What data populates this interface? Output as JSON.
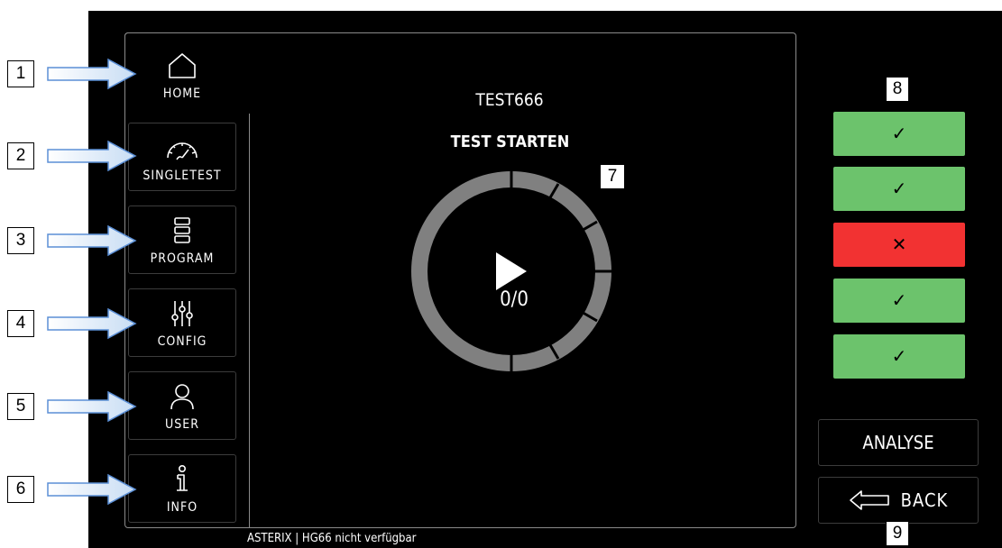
{
  "nav": {
    "home": {
      "label": "HOME",
      "icon": "home-icon"
    },
    "items": [
      {
        "label": "SINGLETEST",
        "icon": "gauge-icon"
      },
      {
        "label": "PROGRAM",
        "icon": "list-icon"
      },
      {
        "label": "CONFIG",
        "icon": "sliders-icon"
      },
      {
        "label": "USER",
        "icon": "user-icon"
      },
      {
        "label": "INFO",
        "icon": "info-icon"
      }
    ]
  },
  "main": {
    "test_name": "TEST666",
    "start_label": "TEST STARTEN",
    "counter": "0/0"
  },
  "results": [
    {
      "status": "pass",
      "symbol": "✓",
      "color": "#6cc36c"
    },
    {
      "status": "pass",
      "symbol": "✓",
      "color": "#6cc36c"
    },
    {
      "status": "fail",
      "symbol": "✕",
      "color": "#f23232"
    },
    {
      "status": "pass",
      "symbol": "✓",
      "color": "#6cc36c"
    },
    {
      "status": "pass",
      "symbol": "✓",
      "color": "#6cc36c"
    }
  ],
  "actions": {
    "analyse_label": "ANALYSE",
    "back_label": "BACK"
  },
  "status_bar": "ASTERIX | HG66 nicht verfügbar",
  "callouts": [
    "1",
    "2",
    "3",
    "4",
    "5",
    "6",
    "7",
    "8",
    "9"
  ]
}
